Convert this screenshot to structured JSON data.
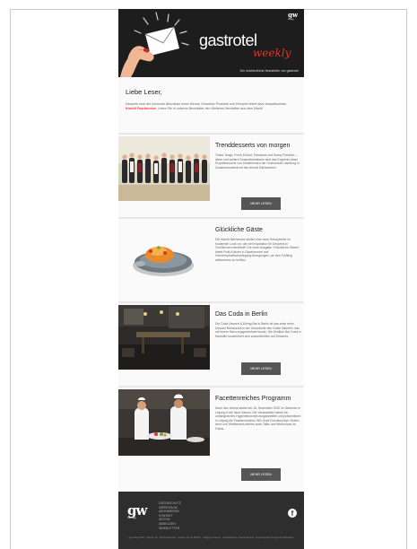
{
  "header": {
    "brand_main": "gastrotel",
    "brand_sub": "weekly",
    "publisher_logo": "gw",
    "publisher_logo_sub": "verlag",
    "tagline": "Der wöchentliche Newsletter von gastrotel"
  },
  "intro": {
    "greeting": "Liebe Leser,",
    "text_before": "Desserts sind der krönende Abschluss eines Menüs. Kreantive Produkte und Rezepte liefert dazu beispielsweise ",
    "highlight": "frischli Foodservice",
    "text_after": ". Lesen Sie in unseren Newsletter den Weiteren Neuheiten aus dem Markt!"
  },
  "articles": [
    {
      "title": "Trenddesserts von morgen",
      "text": "Tonka-Tango, Fresh Erdnut, Panacota und Sunny Pumpkin – diese und weitere Dessertkreationen sind das Ergebnis eines Projektbesuchs von Studierenden der Hochschule Hamburg in Zusammenarbeit mit den frischli Milchwerken.",
      "button": "MEHR LESEN",
      "image_icon": "group-photo-icon"
    },
    {
      "title": "Glückliche Gäste",
      "text": "Die frischli Milchwerke stellen eine neue Rezeptreihe im modernen Look vor, die viel Inspiration für Desserts in Großküchen bereithält. Die erste Ausgabe »Glückliche Gäste« bietet Profi-Küchen in Gastronomie und Gemeinschaftsverpflegung Anregungen, um den Frühling willkommen zu heißen.",
      "button": "",
      "image_icon": "dessert-plate-icon"
    },
    {
      "title": "Das Coda in Berlin",
      "text": "Die Coda Dessert & Dining Bar in Berlin ist das erste reine Dessert-Restaurant in der Geschichte des Guide Michelin, das mit einem Stern ausgezeichnet wurde. Die Schätze Bar Coda in Neukölln konzentriert sich ausschließlich auf Desserts.",
      "button": "MEHR LESEN",
      "image_icon": "restaurant-interior-icon"
    },
    {
      "title": "Facettenreiches Programm",
      "text": "Noch des Jahres startet am 16. November 2020 im Gästorse in Leipzig in die neue Saison. Die Veranstalter haben ein umfangreiches Hygienekonzept ausgearbeitet und präsentieren in Leipzig die Facettenreiches 360-Grad Eventkonzept: Neben dem Live Wettbewerb stehen auch Talks und Workshops im Fokus.",
      "button": "MEHR LESEN",
      "image_icon": "chefs-cooking-icon"
    }
  ],
  "footer": {
    "logo": "gw",
    "logo_sub": "verlag",
    "links": [
      "DATENSCHUTZ",
      "IMPRESSUM",
      "ABONNIEREN",
      "KONTAKT",
      "ARCHIV",
      "ABMELDEN",
      "NEWSLETTER"
    ],
    "social_icon": "facebook-icon",
    "social_glyph": "f",
    "legal": "gw verlag GmbH · Florastr. 20 · 40217 Düsseldorf · Telefon +49 211 88 86 0 · info@gw-verlag.de · Geschäftsführer: Sascha Eickholt · Registergericht: Amtsgericht Düsseldorf"
  },
  "colors": {
    "accent": "#e4322b",
    "header_bg": "#1d1d1d",
    "footer_bg": "#2e2e2e",
    "button_bg": "#555555"
  }
}
